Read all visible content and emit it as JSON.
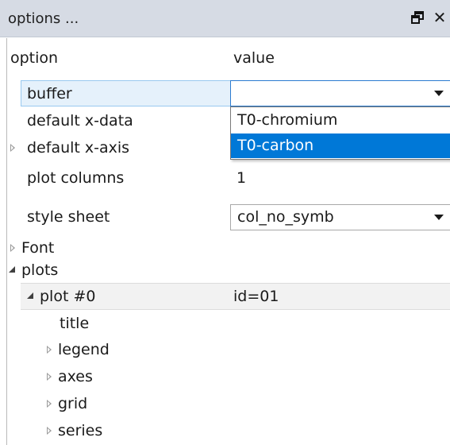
{
  "panel": {
    "title": "options ...",
    "float_icon": "float-window-icon",
    "close_icon": "close-icon"
  },
  "grid": {
    "columns": {
      "option": "option",
      "value": "value"
    },
    "buffer": {
      "label": "buffer",
      "value": ""
    },
    "dropdown": {
      "options": [
        "T0-chromium",
        "T0-carbon"
      ],
      "highlighted": "T0-carbon"
    },
    "default_x_data": {
      "label": "default x-data"
    },
    "default_x_axis": {
      "label": "default x-axis"
    },
    "plot_columns": {
      "label": "plot columns",
      "value": "1"
    },
    "style_sheet": {
      "label": "style sheet",
      "value": "col_no_symb"
    },
    "font": {
      "label": "Font"
    },
    "plots": {
      "label": "plots"
    },
    "plot0": {
      "label": "plot #0",
      "value": "id=01"
    },
    "title": {
      "label": "title"
    },
    "legend": {
      "label": "legend"
    },
    "axes": {
      "label": "axes"
    },
    "grid": {
      "label": "grid"
    },
    "series": {
      "label": "series"
    }
  },
  "colors": {
    "titlebar": "#d6dbe4",
    "selection": "#0078d7",
    "row_highlight": "#e5f1fb"
  }
}
